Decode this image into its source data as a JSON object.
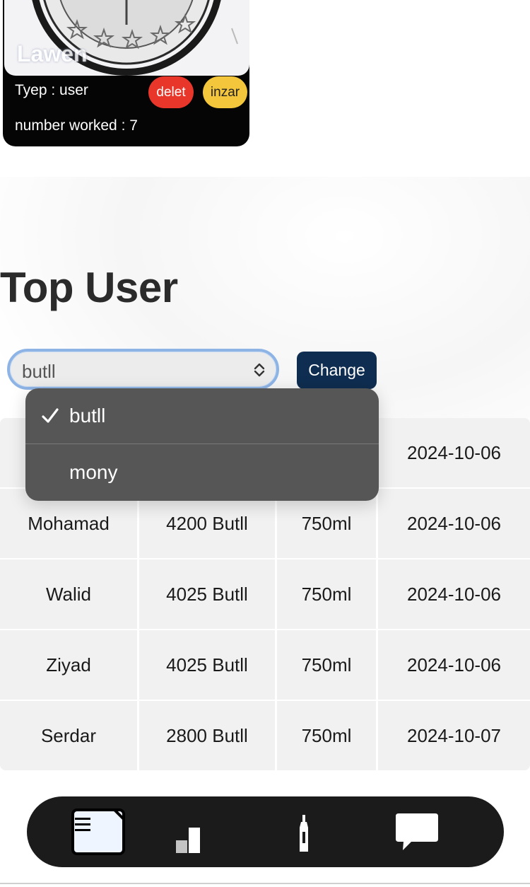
{
  "user_card": {
    "name": "Lawen",
    "type_line": "Tyep : user",
    "worked_line": "number worked : 7",
    "delete_label": "delet",
    "warn_label": "inzar",
    "delete_color": "#e8372a",
    "warn_color": "#f3c63c"
  },
  "top_user": {
    "title": "Top User",
    "select": {
      "value": "butll",
      "options": [
        "butll",
        "mony"
      ],
      "selected_index": 0
    },
    "change_label": "Change",
    "change_color": "#0f2d50"
  },
  "table": {
    "rows": [
      {
        "name": "",
        "amount": "",
        "size": "",
        "date": "2024-10-06"
      },
      {
        "name": "Mohamad",
        "amount": "4200 Butll",
        "size": "750ml",
        "date": "2024-10-06"
      },
      {
        "name": "Walid",
        "amount": "4025 Butll",
        "size": "750ml",
        "date": "2024-10-06"
      },
      {
        "name": "Ziyad",
        "amount": "4025 Butll",
        "size": "750ml",
        "date": "2024-10-06"
      },
      {
        "name": "Serdar",
        "amount": "2800 Butll",
        "size": "750ml",
        "date": "2024-10-07"
      }
    ]
  },
  "dropdown": {
    "options": [
      {
        "label": "butll",
        "checked": true
      },
      {
        "label": "mony",
        "checked": false
      }
    ]
  },
  "bottom_nav": {
    "items": [
      "list-icon",
      "bar-chart-icon",
      "bottle-icon",
      "chat-bubble-icon"
    ],
    "active_index": 0
  }
}
